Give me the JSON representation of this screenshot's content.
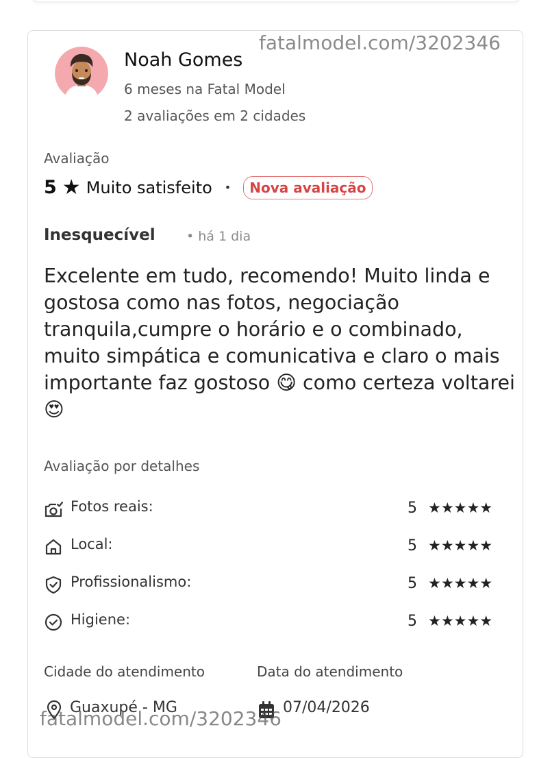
{
  "watermark": "fatalmodel.com/3202346",
  "reviewer": {
    "name": "Noah Gomes",
    "member_since": "6 meses na Fatal Model",
    "review_count": "2 avaliações em 2 cidades"
  },
  "rating": {
    "label": "Avaliação",
    "score": "5",
    "star": "★",
    "text": "Muito satisfeito",
    "separator": "•",
    "badge": "Nova avaliação"
  },
  "review": {
    "title": "Inesquecível",
    "time": "• há 1 dia",
    "text": "Excelente em tudo, recomendo! Muito linda e gostosa como nas fotos, negociação tranquila,cumpre o horário e o combinado, muito simpática e comunicativa e claro o mais importante faz gostoso 😋 como certeza voltarei 😍"
  },
  "details": {
    "label": "Avaliação por detalhes",
    "items": [
      {
        "label": "Fotos reais:",
        "value": "5",
        "stars": "★★★★★",
        "icon": "camera-check-icon"
      },
      {
        "label": "Local:",
        "value": "5",
        "stars": "★★★★★",
        "icon": "home-icon"
      },
      {
        "label": "Profissionalismo:",
        "value": "5",
        "stars": "★★★★★",
        "icon": "shield-check-icon"
      },
      {
        "label": "Higiene:",
        "value": "5",
        "stars": "★★★★★",
        "icon": "check-circle-icon"
      }
    ]
  },
  "service": {
    "city_label": "Cidade do atendimento",
    "city": "Guaxupé - MG",
    "date_label": "Data do atendimento",
    "date": "07/04/2026"
  }
}
